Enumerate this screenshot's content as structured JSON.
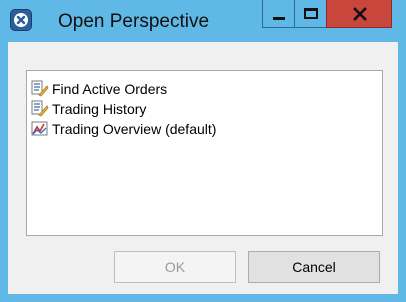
{
  "window": {
    "title": "Open Perspective",
    "app_icon": "eclipse-close-badge-icon",
    "controls": {
      "minimize_icon": "minimize-icon",
      "maximize_icon": "maximize-icon",
      "close_icon": "close-icon"
    },
    "titlebar_color": "#5fb8e5",
    "close_color": "#c9463d"
  },
  "perspectives": {
    "items": [
      {
        "label": "Find Active Orders",
        "icon": "orders-perspective-icon"
      },
      {
        "label": "Trading History",
        "icon": "orders-perspective-icon"
      },
      {
        "label": "Trading Overview (default)",
        "icon": "chart-perspective-icon"
      }
    ]
  },
  "buttons": {
    "ok_label": "OK",
    "ok_enabled": false,
    "cancel_label": "Cancel"
  }
}
